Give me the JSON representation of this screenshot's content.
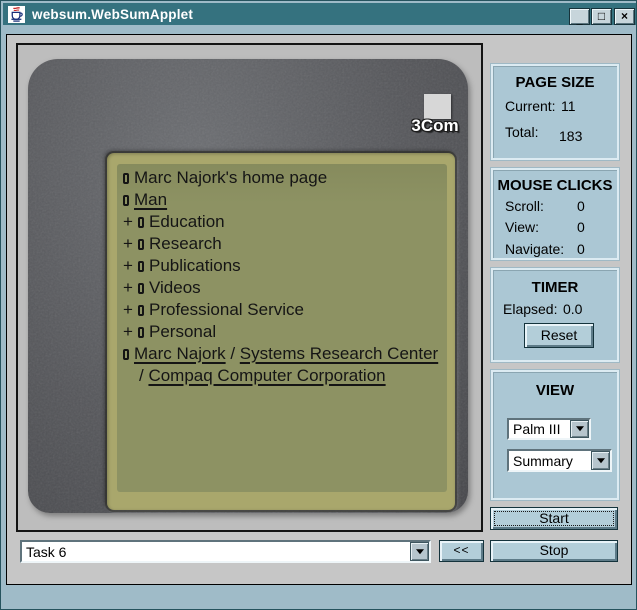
{
  "colors": {
    "titlebar": "#35727f",
    "window_frame": "#9fbbc8",
    "applet_bg": "#c6c6c6",
    "photo_bg": "#bdbdbd",
    "device_body": "#56575b",
    "screen_outer": "#a9a76c",
    "screen_inner": "#8d9263",
    "screen_text": "#151515",
    "panel_bg": "#abc7d4",
    "button_bg": "#b3ced9"
  },
  "window": {
    "title": "websum.WebSumApplet",
    "controls": {
      "minimize": "_",
      "maximize": "□",
      "close": "×"
    }
  },
  "device": {
    "logo_text": "3Com",
    "screen": {
      "items": [
        {
          "prefix": "",
          "segments": [
            {
              "text": "Marc Najork's home page",
              "link": false
            }
          ]
        },
        {
          "prefix": "",
          "segments": [
            {
              "text": "Man",
              "link": true
            }
          ]
        },
        {
          "prefix": "+",
          "segments": [
            {
              "text": "Education",
              "link": false
            }
          ]
        },
        {
          "prefix": "+",
          "segments": [
            {
              "text": "Research",
              "link": false
            }
          ]
        },
        {
          "prefix": "+",
          "segments": [
            {
              "text": "Publications",
              "link": false
            }
          ]
        },
        {
          "prefix": "+",
          "segments": [
            {
              "text": "Videos",
              "link": false
            }
          ]
        },
        {
          "prefix": "+",
          "segments": [
            {
              "text": "Professional Service",
              "link": false
            }
          ]
        },
        {
          "prefix": "+",
          "segments": [
            {
              "text": "Personal",
              "link": false
            }
          ]
        },
        {
          "prefix": "",
          "wrap": true,
          "segments": [
            {
              "text": "Marc Najork",
              "link": true
            },
            {
              "text": " / ",
              "link": false
            },
            {
              "text": "Systems Research Center",
              "link": true
            },
            {
              "text": " / ",
              "link": false
            },
            {
              "text": "Compaq Computer Corporation",
              "link": true
            }
          ]
        }
      ]
    }
  },
  "panels": {
    "page_size": {
      "title": "PAGE SIZE",
      "rows": [
        {
          "label": "Current:",
          "value": "11"
        },
        {
          "label": "Total:",
          "value": "183"
        }
      ]
    },
    "mouse_clicks": {
      "title": "MOUSE CLICKS",
      "rows": [
        {
          "label": "Scroll:",
          "value": "0"
        },
        {
          "label": "View:",
          "value": "0"
        },
        {
          "label": "Navigate:",
          "value": "0"
        }
      ]
    },
    "timer": {
      "title": "TIMER",
      "elapsed_label": "Elapsed:",
      "elapsed_value": "0.0",
      "reset_label": "Reset"
    },
    "view": {
      "title": "VIEW",
      "device_value": "Palm III",
      "mode_value": "Summary"
    },
    "start_label": "Start",
    "stop_label": "Stop"
  },
  "taskbar": {
    "task_value": "Task 6",
    "back_label": "<<"
  }
}
